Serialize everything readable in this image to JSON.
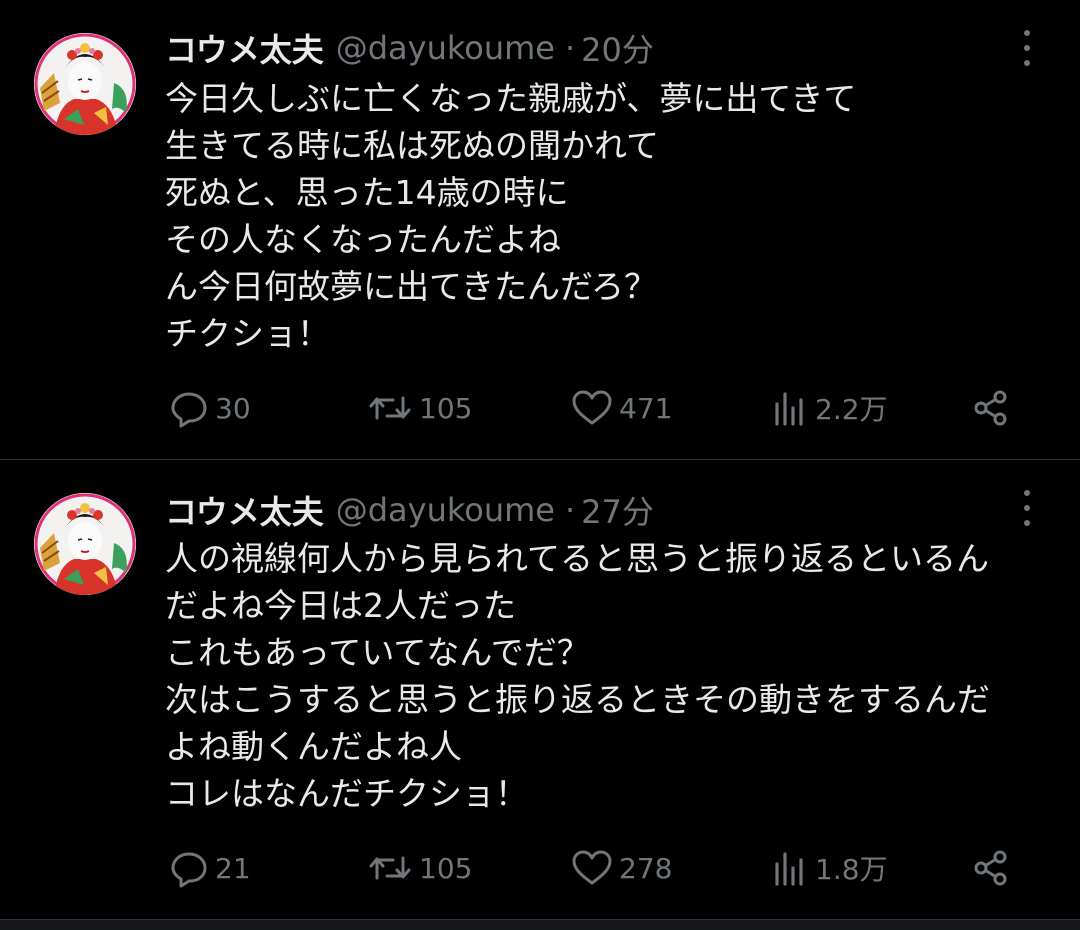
{
  "tweets": [
    {
      "author_name": "コウメ太夫",
      "handle": "@dayukoume",
      "separator": "·",
      "time": "20分",
      "lines": [
        "今日久しぶに亡くなった親戚が、夢に出てきて",
        "生きてる時に私は死ぬの聞かれて",
        "死ぬと、思った14歳の時に",
        "その人なくなったんだよね",
        "ん今日何故夢に出てきたんだろ？",
        "チクショ！"
      ],
      "replies": "30",
      "retweets": "105",
      "likes": "471",
      "views": "2.2万"
    },
    {
      "author_name": "コウメ太夫",
      "handle": "@dayukoume",
      "separator": "·",
      "time": "27分",
      "lines": [
        "人の視線何人から見られてると思うと振り返るといるん",
        "だよね今日は2人だった",
        "これもあっていてなんでだ？",
        "次はこうすると思うと振り返るときその動きをするんだ",
        "よね動くんだよね人",
        "コレはなんだチクショ！"
      ],
      "replies": "21",
      "retweets": "105",
      "likes": "278",
      "views": "1.8万"
    }
  ],
  "icons": {
    "more": "more-dots-icon",
    "reply": "reply-bubble-icon",
    "retweet": "retweet-arrows-icon",
    "like": "heart-icon",
    "views": "views-bars-icon",
    "share": "share-nodes-icon"
  },
  "colors": {
    "background": "#000000",
    "text": "#e7e9ea",
    "muted": "#71767b",
    "divider": "#2f3336",
    "avatar_ring": "#e0307a"
  }
}
